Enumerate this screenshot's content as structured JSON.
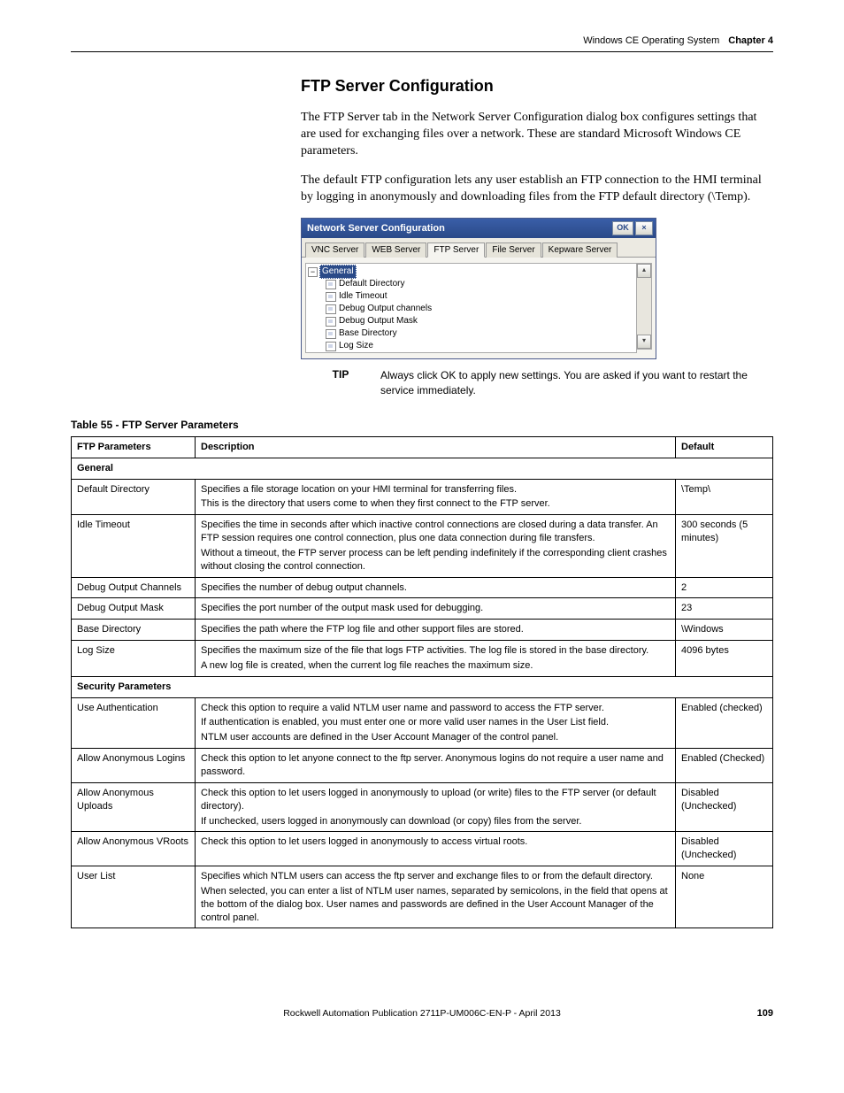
{
  "header": {
    "running_head": "Windows CE Operating System",
    "chapter": "Chapter 4"
  },
  "section": {
    "title": "FTP Server Configuration",
    "para1": "The FTP Server tab in the Network Server Configuration dialog box configures settings that are used for exchanging files over a network. These are standard Microsoft Windows CE parameters.",
    "para2": "The default FTP configuration lets any user establish an FTP connection to the HMI terminal by logging in anonymously and downloading files from the FTP default directory (\\Temp)."
  },
  "dialog": {
    "title": "Network Server Configuration",
    "buttons": {
      "ok": "OK",
      "close": "×"
    },
    "tabs": [
      "VNC Server",
      "WEB Server",
      "FTP Server",
      "File Server",
      "Kepware Server"
    ],
    "active_tab_index": 2,
    "tree": {
      "root": "General",
      "children": [
        "Default Directory",
        "Idle Timeout",
        "Debug Output channels",
        "Debug Output Mask",
        "Base Directory",
        "Log Size"
      ]
    }
  },
  "tip": {
    "label": "TIP",
    "text": "Always click OK to apply new settings. You are asked if you want to restart the service immediately."
  },
  "table": {
    "caption": "Table 55 - FTP Server Parameters",
    "headers": {
      "col1": "FTP Parameters",
      "col2": "Description",
      "col3": "Default"
    },
    "group1": "General",
    "rows1": [
      {
        "name": "Default Directory",
        "desc": [
          "Specifies a file storage location on your HMI terminal for transferring files.",
          "This is the directory that users come to when they first connect to the FTP server."
        ],
        "def": "\\Temp\\"
      },
      {
        "name": "Idle Timeout",
        "desc": [
          "Specifies the time in seconds after which inactive control connections are closed during a data transfer. An FTP session requires one control connection, plus one data connection during file transfers.",
          "Without a timeout, the FTP server process can be left pending indefinitely if the corresponding client crashes without closing the control connection."
        ],
        "def": "300 seconds (5 minutes)"
      },
      {
        "name": "Debug Output Channels",
        "desc": [
          "Specifies the number of debug output channels."
        ],
        "def": "2"
      },
      {
        "name": "Debug Output Mask",
        "desc": [
          "Specifies the port number of the output mask used for debugging."
        ],
        "def": "23"
      },
      {
        "name": "Base Directory",
        "desc": [
          "Specifies the path where the FTP log file and other support files are stored."
        ],
        "def": "\\Windows"
      },
      {
        "name": "Log Size",
        "desc": [
          "Specifies the maximum size of the file that logs FTP activities. The log file is stored in the base directory.",
          "A new log file is created, when the current log file reaches the maximum size."
        ],
        "def": "4096 bytes"
      }
    ],
    "group2": "Security Parameters",
    "rows2": [
      {
        "name": "Use Authentication",
        "desc": [
          "Check this option to require a valid NTLM user name and password to access the FTP server.",
          "If authentication is enabled, you must enter one or more valid user names in the User List field.",
          "NTLM user accounts are defined in the User Account Manager of the control panel."
        ],
        "def": "Enabled (checked)"
      },
      {
        "name": "Allow Anonymous Logins",
        "desc": [
          "Check this option to let anyone connect to the ftp server. Anonymous logins do not require a user name and password."
        ],
        "def": "Enabled (Checked)"
      },
      {
        "name": "Allow Anonymous Uploads",
        "desc": [
          "Check this option to let users logged in anonymously to upload (or write) files to the FTP server (or default directory).",
          "If unchecked, users logged in anonymously can download (or copy) files from the server."
        ],
        "def": "Disabled (Unchecked)"
      },
      {
        "name": "Allow Anonymous VRoots",
        "desc": [
          "Check this option to let users logged in anonymously to access virtual roots."
        ],
        "def": "Disabled (Unchecked)"
      },
      {
        "name": "User List",
        "desc": [
          "Specifies which NTLM users can access the ftp server and exchange files to or from the default directory.",
          "When selected, you can enter a list of NTLM user names, separated by semicolons, in the field that opens at the bottom of the dialog box. User names and passwords are defined in the User Account Manager of the control panel."
        ],
        "def": "None"
      }
    ]
  },
  "footer": {
    "text": "Rockwell Automation Publication 2711P-UM006C-EN-P - April 2013",
    "page": "109"
  }
}
